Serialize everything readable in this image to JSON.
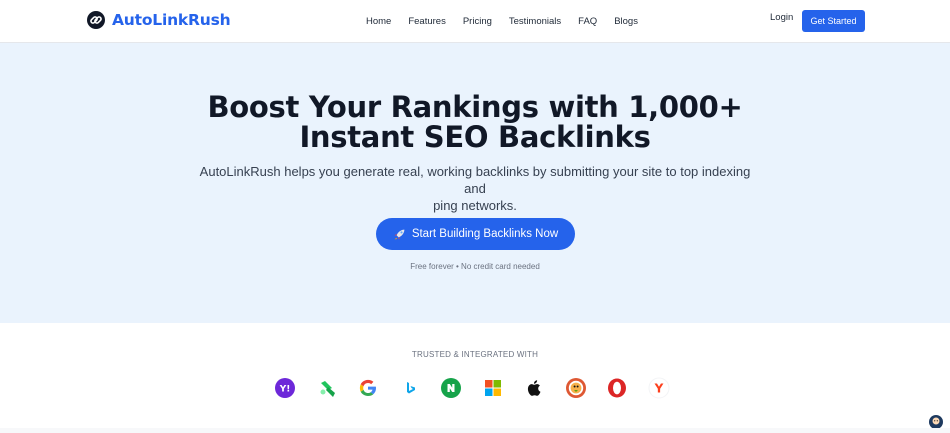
{
  "brand": {
    "name": "AutoLinkRush",
    "color": "#2563eb"
  },
  "nav": {
    "items": [
      "Home",
      "Features",
      "Pricing",
      "Testimonials",
      "FAQ",
      "Blogs"
    ],
    "login": "Login",
    "cta": "Get Started"
  },
  "hero": {
    "headline_line1": "Boost Your Rankings with 1,000+",
    "headline_line2": "Instant SEO Backlinks",
    "subtext_line1": "AutoLinkRush helps you generate real, working backlinks by submitting your site to top indexing and",
    "subtext_line2": "ping networks.",
    "cta_label": "Start Building Backlinks Now",
    "cta_icon": "rocket-icon",
    "note": "Free forever • No credit card needed",
    "background": "#eaf3fd"
  },
  "trusted": {
    "label": "TRUSTED & INTEGRATED WITH",
    "logos": [
      "yahoo-icon",
      "bitly-icon",
      "google-icon",
      "bing-icon",
      "naver-icon",
      "microsoft-icon",
      "apple-icon",
      "duckduckgo-icon",
      "opera-icon",
      "yandex-icon"
    ]
  }
}
